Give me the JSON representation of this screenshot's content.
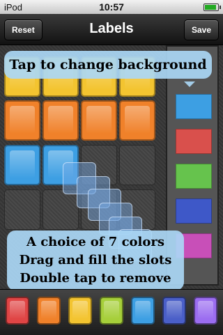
{
  "status": {
    "carrier": "iPod",
    "time": "10:57",
    "battery_level": 0.9
  },
  "nav": {
    "title": "Labels",
    "reset_label": "Reset",
    "save_label": "Save"
  },
  "colors": {
    "yellow": "#f3c430",
    "orange": "#f0812a",
    "blue": "#3d9fe3",
    "red": "#e04545",
    "green": "#77c24a",
    "purple": "#8d5bd6",
    "indigo": "#4a5fc8",
    "magenta": "#c84fb8"
  },
  "grid_tiles": [
    [
      "yellow",
      "yellow",
      "yellow",
      "yellow"
    ],
    [
      "orange",
      "orange",
      "orange",
      "orange"
    ],
    [
      "blue",
      "blue",
      "empty",
      "empty"
    ],
    [
      "empty",
      "empty",
      "empty",
      "empty"
    ]
  ],
  "background_swatches": [
    "#3d9fe3",
    "#d9504c",
    "#66c34d",
    "#3e58c8",
    "#c84fb8"
  ],
  "callouts": {
    "top": "Tap to change background",
    "bottom": [
      "A choice of 7 colors",
      "Drag and fill the slots",
      "Double tap to remove"
    ]
  },
  "tray_colors": [
    "#e04545",
    "#f0812a",
    "#f3c430",
    "#a6cf3a",
    "#3d9fe3",
    "#4a5fc8",
    "#9b6df0"
  ]
}
